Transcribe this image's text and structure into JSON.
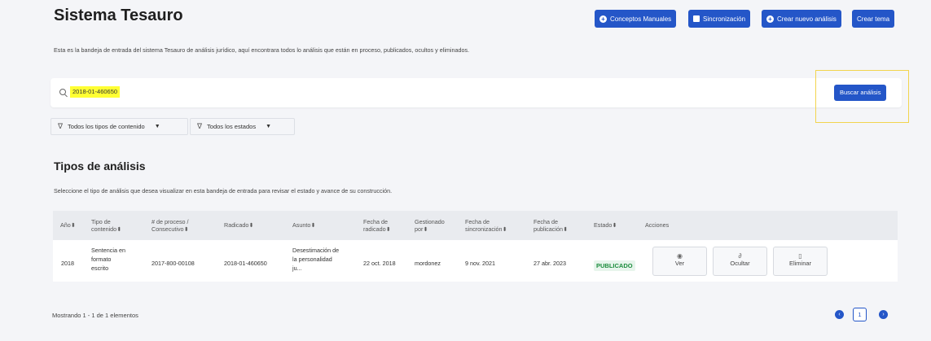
{
  "header": {
    "title": "Sistema Tesauro",
    "buttons": {
      "manual_concepts": "Conceptos Manuales",
      "sync": "Sincronización",
      "new_analysis": "Crear nuevo análisis",
      "new_topic": "Crear tema"
    }
  },
  "intro": {
    "description": "Esta es la bandeja de entrada del sistema Tesauro de análisis jurídico, aquí encontrara todos lo análisis que están en proceso, publicados, ocultos y eliminados."
  },
  "search": {
    "value": "2018-01-460650",
    "button_label": "Buscar análisis"
  },
  "filters": {
    "content_types": "Todos los tipos de contenido",
    "states": "Todos los estados"
  },
  "section": {
    "title": "Tipos de análisis",
    "description": "Seleccione el tipo de análisis que desea visualizar en esta bandeja de entrada para revisar el estado y avance de su construcción."
  },
  "table": {
    "headers": {
      "year": "Año",
      "content_type_1": "Tipo de",
      "content_type_2": "contenido",
      "process_1": "# de proceso /",
      "process_2": "Consecutivo",
      "filed": "Radicado",
      "subject": "Asunto",
      "filed_date_1": "Fecha de",
      "filed_date_2": "radicado",
      "managed_1": "Gestionado",
      "managed_2": "por",
      "sync_date_1": "Fecha de",
      "sync_date_2": "sincronización",
      "pub_date_1": "Fecha de",
      "pub_date_2": "publicación",
      "status": "Estado",
      "actions": "Acciones"
    },
    "sort_glyph": "⬍",
    "row": {
      "year": "2018",
      "content_type_1": "Sentencia en",
      "content_type_2": "formato",
      "content_type_3": "escrito",
      "process": "2017-800-00108",
      "filed": "2018-01-460650",
      "subject_1": "Desestimación de",
      "subject_2": "la personalidad",
      "subject_3": "ju...",
      "filed_date": "22 oct. 2018",
      "managed_by": "mordonez",
      "sync_date": "9 nov. 2021",
      "pub_date": "27 abr. 2023",
      "status": "PUBLICADO",
      "actions": {
        "view": "Ver",
        "hide": "Ocultar",
        "delete": "Eliminar"
      }
    }
  },
  "footer": {
    "showing": "Mostrando 1 - 1 de 1 elementos",
    "current_page": "1"
  },
  "colors": {
    "accent": "#2456c8",
    "success": "#1b8c3c",
    "highlight": "#ffff33",
    "background": "#f4f5f8"
  }
}
